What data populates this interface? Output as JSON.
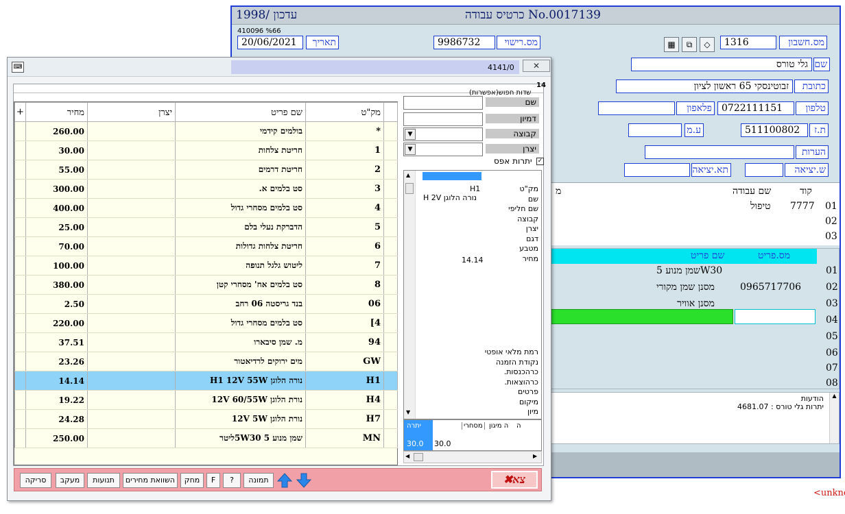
{
  "back_window": {
    "title_left": "עדכון /1998",
    "title_center": "כרטיס עבודה No.0017139",
    "small_code": "410096 %66",
    "date_label": "תאריך",
    "date_value": "20/06/2021",
    "license_label": "מס.רישוי",
    "license_value": "9986732",
    "account_label": "מס.חשבון",
    "account_value": "1316",
    "name_label": "שם",
    "name_value": "גלי טורס",
    "address_label": "כתובת",
    "address_value": "זבוטינסקי 65 ראשון לציון",
    "phone_label": "טלפון",
    "phone_value": "0722111151",
    "mobile_label": "פלאפון",
    "mobile_value": "",
    "id_label": "ת.ז",
    "id_value": "511100802",
    "vat_label": "ע.מ",
    "vat_value": "",
    "notes_label": "הערות",
    "notes_value": "",
    "exit_time_label": "ש.יציאה",
    "exit_date_label": "תא.יציאה",
    "services_header": {
      "code": "קוד",
      "name": "שם עבודה",
      "extra": "מ"
    },
    "services": [
      {
        "line": "01",
        "code": "7777",
        "name": "טיפול"
      },
      {
        "line": "02",
        "code": "",
        "name": ""
      },
      {
        "line": "03",
        "code": "",
        "name": ""
      }
    ],
    "parts_header": {
      "part_no": "מס.פריט",
      "part_name": "שם פריט"
    },
    "parts": [
      {
        "line": "01",
        "part_no": "",
        "part_name": "שמן מנוע 5W30"
      },
      {
        "line": "02",
        "part_no": "0965717706",
        "part_name": "מסנן שמן מקורי"
      },
      {
        "line": "03",
        "part_no": "",
        "part_name": "מסנן אוויר"
      },
      {
        "line": "04",
        "part_no": "",
        "part_name": ""
      },
      {
        "line": "05",
        "part_no": "",
        "part_name": ""
      },
      {
        "line": "06",
        "part_no": "",
        "part_name": ""
      },
      {
        "line": "07",
        "part_no": "",
        "part_name": ""
      },
      {
        "line": "08",
        "part_no": "",
        "part_name": ""
      }
    ],
    "messages_label": "הודעות",
    "messages_text": "יתרות גלי טורס : 4681.07"
  },
  "dialog": {
    "title_code": "4141/0",
    "close_label": "✕",
    "counter": "14",
    "search_mode": "שדות חפוש(אפשרות)",
    "search_labels": {
      "name": "שם",
      "similar": "דמיון",
      "group": "קבוצה",
      "maker": "יצרן"
    },
    "zero_balance_label": "יתרות אפס",
    "grid_headers": {
      "plus": "+",
      "price": "מחיר",
      "maker": "יצרן",
      "name": "שם פריט",
      "sku": "מק\"ט"
    },
    "rows": [
      {
        "price": "260.00",
        "maker": "",
        "name": "בולמים קידמי",
        "sku": "*"
      },
      {
        "price": "30.00",
        "maker": "",
        "name": "חריטת צלחות",
        "sku": "1"
      },
      {
        "price": "55.00",
        "maker": "",
        "name": "חריטת דרמים",
        "sku": "2"
      },
      {
        "price": "300.00",
        "maker": "",
        "name": "סט בלמים א.",
        "sku": "3"
      },
      {
        "price": "400.00",
        "maker": "",
        "name": "סט בלמים מסחרי גדול",
        "sku": "4"
      },
      {
        "price": "25.00",
        "maker": "",
        "name": "הדברקת נעלי בלם",
        "sku": "5"
      },
      {
        "price": "70.00",
        "maker": "",
        "name": "חריטת צלחות גדולות",
        "sku": "6"
      },
      {
        "price": "100.00",
        "maker": "",
        "name": "ליטוש גלגל תנופה",
        "sku": "7"
      },
      {
        "price": "380.00",
        "maker": "",
        "name": "סט בלמים אח' מסחרי קטן",
        "sku": "8"
      },
      {
        "price": "2.50",
        "maker": "",
        "name": "בנד גריסטה 06 רחב",
        "sku": "06"
      },
      {
        "price": "220.00",
        "maker": "",
        "name": "סט בלמים מסחרי גדול",
        "sku": "[4"
      },
      {
        "price": "37.51",
        "maker": "",
        "name": "מ. שמן סיבארו",
        "sku": "94"
      },
      {
        "price": "23.26",
        "maker": "",
        "name": "מים ירוקים לרדיאטור",
        "sku": "GW"
      },
      {
        "price": "14.14",
        "maker": "",
        "name": "נורה הלוגן H1 12V 55W",
        "sku": "H1"
      },
      {
        "price": "19.22",
        "maker": "",
        "name": "נורת הלוגן 12V 60/55W",
        "sku": "H4"
      },
      {
        "price": "24.28",
        "maker": "",
        "name": "נורת הלוגן 12V 5W",
        "sku": "H7"
      },
      {
        "price": "250.00",
        "maker": "",
        "name": "שמן מנוע 5W30 5ליטר",
        "sku": "MN"
      }
    ],
    "selected_index": 13,
    "detail": {
      "labels": [
        "מק\"ט",
        "שם",
        "שם חליפי",
        "קבוצה",
        "יצרן",
        "דגם",
        "מטבע",
        "מחיר"
      ],
      "sku": "H1",
      "name": "נורה הלוגן H 2V",
      "price": "14.14",
      "lower_labels": [
        "רמת מלאי אופטי",
        "נקודת הזמנה",
        "כרהכנסות.",
        "כרהוצאות.",
        "פרטים",
        "מיקום",
        "מיון"
      ]
    },
    "bottom_table": {
      "headers": [
        "יתרה",
        "",
        "מסחרי",
        "ה מיגון",
        "ה"
      ],
      "values": [
        "30.0",
        "30.0"
      ]
    },
    "toolbar": {
      "exit": "צא",
      "scan": "סריקה",
      "track": "מעקב",
      "movements": "תנועות",
      "price_compare": "השוואת מחירים",
      "delete": "מחק",
      "f": "F",
      "help": "?",
      "image": "תמונה"
    }
  },
  "stray_text": "<unkno"
}
